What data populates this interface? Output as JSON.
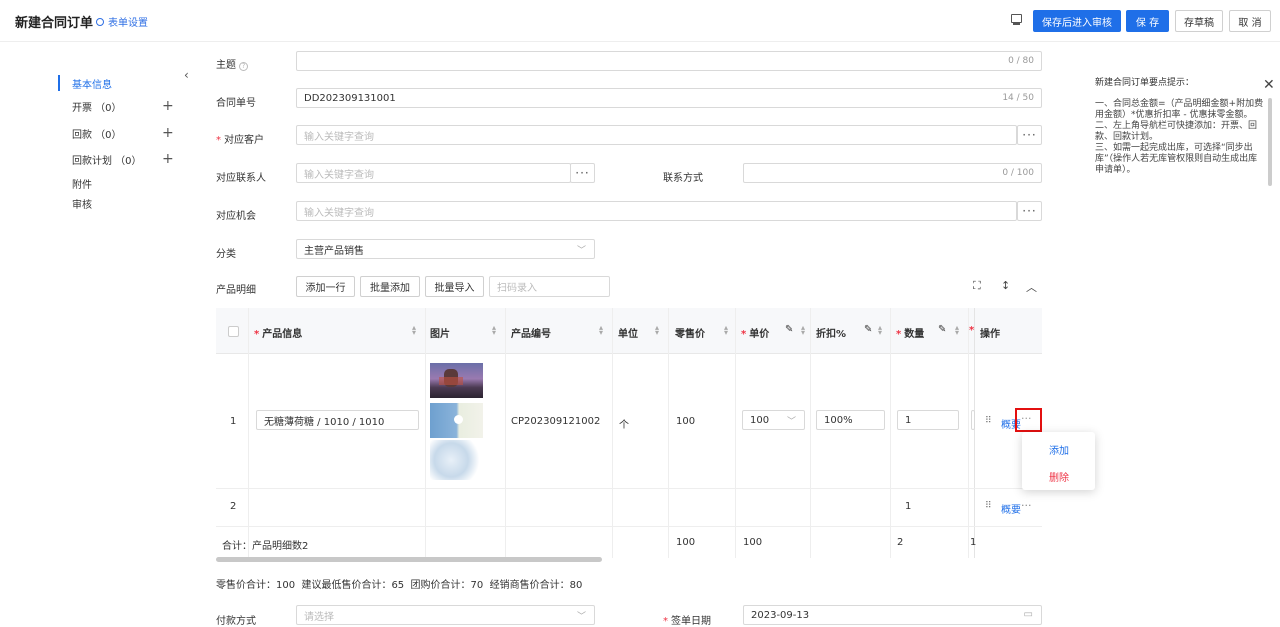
{
  "header": {
    "title": "新建合同订单",
    "form_settings": "表单设置",
    "save_and_review": "保存后进入审核",
    "save": "保 存",
    "save_draft": "存草稿",
    "cancel": "取 消"
  },
  "sidebar": {
    "items": [
      {
        "label": "基本信息"
      },
      {
        "label": "开票 （0）"
      },
      {
        "label": "回款 （0）"
      },
      {
        "label": "回款计划 （0）"
      },
      {
        "label": "附件"
      },
      {
        "label": "审核"
      }
    ]
  },
  "form": {
    "subject": {
      "label": "主题",
      "counter": "0 / 80",
      "help": "?"
    },
    "contract_no": {
      "label": "合同单号",
      "value": "DD202309131001",
      "counter": "14 / 50"
    },
    "customer": {
      "label": "对应客户",
      "placeholder": "输入关键字查询"
    },
    "contact": {
      "label": "对应联系人",
      "placeholder": "输入关键字查询"
    },
    "contact_method": {
      "label": "联系方式",
      "counter": "0 / 100"
    },
    "opportunity": {
      "label": "对应机会",
      "placeholder": "输入关键字查询"
    },
    "category": {
      "label": "分类",
      "value": "主营产品销售"
    },
    "products_label": "产品明细",
    "add_row": "添加一行",
    "batch_add": "批量添加",
    "batch_import": "批量导入",
    "scan_placeholder": "扫码录入",
    "summary": "零售价合计：100  建议最低售价合计：65  团购价合计：70  经销商售价合计：80",
    "payment_method": {
      "label": "付款方式",
      "placeholder": "请选择"
    },
    "sign_date": {
      "label": "签单日期",
      "value": "2023-09-13"
    }
  },
  "table": {
    "headers": {
      "product_info": "产品信息",
      "image": "图片",
      "product_code": "产品编号",
      "unit": "单位",
      "retail_price": "零售价",
      "unit_price": "单价",
      "discount": "折扣%",
      "quantity": "数量",
      "actions": "操作"
    },
    "rows": [
      {
        "index": "1",
        "product": "无糖薄荷糖 / 1010 / 1010",
        "code": "CP202309121002",
        "unit": "个",
        "retail": "100",
        "price": "100",
        "discount": "100%",
        "qty": "1",
        "detail": "概要"
      },
      {
        "index": "2",
        "product": "",
        "code": "",
        "unit": "",
        "retail": "",
        "price": "",
        "discount": "",
        "qty": "1",
        "detail": "概要"
      }
    ],
    "total": {
      "label": "合计：产品明细数2",
      "retail": "100",
      "price": "100",
      "qty": "2",
      "extra": "1"
    },
    "overflow_qty": "1"
  },
  "popup": {
    "add": "添加",
    "delete": "删除"
  },
  "tips": {
    "title": "新建合同订单要点提示：",
    "line1": "一、合同总金额=（产品明细金额+附加费用金额）*优惠折扣率 - 优惠抹零金额。",
    "line2": "二、左上角导航栏可快捷添加：开票、回款、回款计划。",
    "line3": "三、如需一起完成出库，可选择“同步出库”（操作人若无库管权限则自动生成出库申请单）。"
  }
}
